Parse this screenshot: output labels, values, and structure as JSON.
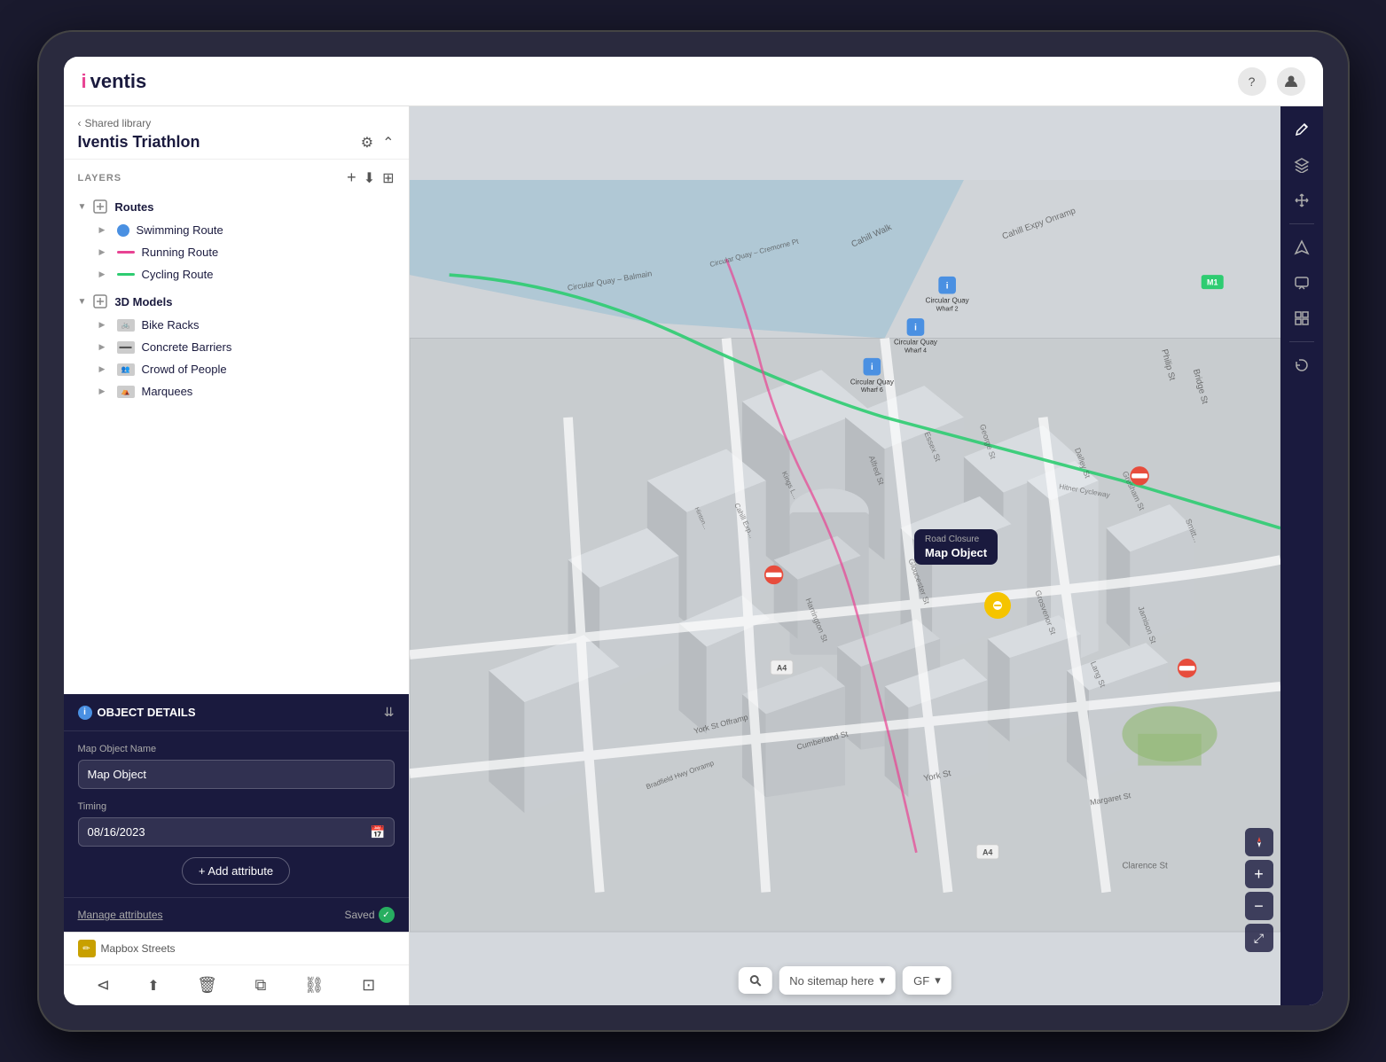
{
  "app": {
    "name": "iventis",
    "name_colored": "i",
    "name_rest": "ventis"
  },
  "topbar": {
    "help_btn": "?",
    "user_btn": "👤"
  },
  "sidebar": {
    "breadcrumb": "Shared library",
    "title": "Iventis Triathlon",
    "layers_label": "LAYERS",
    "layers_groups": [
      {
        "name": "Routes",
        "items": [
          {
            "name": "Swimming Route",
            "color": "#4a90e2",
            "type": "dot"
          },
          {
            "name": "Running Route",
            "color": "#e84393",
            "type": "line"
          },
          {
            "name": "Cycling Route",
            "color": "#2ecc71",
            "type": "line"
          }
        ]
      },
      {
        "name": "3D Models",
        "items": [
          {
            "name": "Bike Racks",
            "color": "#888",
            "type": "img"
          },
          {
            "name": "Concrete Barriers",
            "color": "#999",
            "type": "img"
          },
          {
            "name": "Crowd of People",
            "color": "#888",
            "type": "img"
          },
          {
            "name": "Marquees",
            "color": "#888",
            "type": "img"
          }
        ]
      }
    ]
  },
  "object_details": {
    "title": "OBJECT DETAILS",
    "name_label": "Map Object Name",
    "name_value": "Map Object",
    "timing_label": "Timing",
    "timing_value": "08/16/2023",
    "add_attribute_btn": "+ Add attribute",
    "manage_attrs": "Manage attributes",
    "saved_text": "Saved"
  },
  "mapbox": {
    "label": "Mapbox Streets",
    "pencil": "✏"
  },
  "map": {
    "tooltip_title": "Road Closure",
    "tooltip_value": "Map Object",
    "search_placeholder": "Search",
    "sitemap_label": "No sitemap here",
    "floor_label": "GF",
    "a4_badge": "A4",
    "m1_badge": "M1"
  },
  "right_toolbar": {
    "buttons": [
      {
        "name": "edit-icon",
        "icon": "✏",
        "label": "Edit"
      },
      {
        "name": "layers-icon",
        "icon": "⊞",
        "label": "Layers"
      },
      {
        "name": "move-icon",
        "icon": "⤢",
        "label": "Move"
      },
      {
        "name": "draw-icon",
        "icon": "△",
        "label": "Draw"
      },
      {
        "name": "comment-icon",
        "icon": "💬",
        "label": "Comment"
      },
      {
        "name": "grid-icon",
        "icon": "▦",
        "label": "Grid"
      },
      {
        "name": "refresh-icon",
        "icon": "↻",
        "label": "Refresh"
      }
    ]
  },
  "bottom_toolbar": {
    "buttons": [
      {
        "name": "share-icon",
        "icon": "⊲",
        "label": "Share"
      },
      {
        "name": "export-icon",
        "icon": "⬆",
        "label": "Export"
      },
      {
        "name": "delete-icon",
        "icon": "🗑",
        "label": "Delete"
      },
      {
        "name": "duplicate-icon",
        "icon": "⧉",
        "label": "Duplicate"
      },
      {
        "name": "link-icon",
        "icon": "⛓",
        "label": "Link"
      },
      {
        "name": "select-icon",
        "icon": "⊡",
        "label": "Select"
      }
    ]
  }
}
